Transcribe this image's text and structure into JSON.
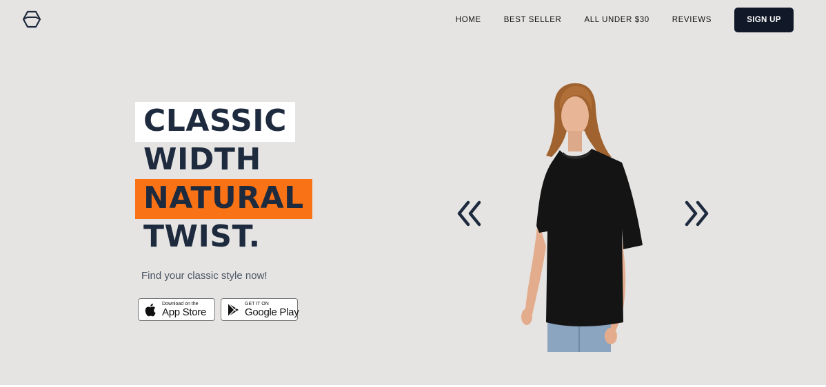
{
  "header": {
    "logo": "hexagon-logo-icon",
    "nav": [
      "HOME",
      "BEST SELLER",
      "ALL UNDER $30",
      "REVIEWS"
    ],
    "signup_label": "SIGN UP"
  },
  "hero": {
    "headline": [
      "CLASSIC",
      "WIDTH",
      "NATURAL",
      "TWIST."
    ],
    "subtitle": "Find your classic style now!",
    "app_store": {
      "small": "Download on the",
      "big": "App Store"
    },
    "google_play": {
      "small": "GET IT ON",
      "big": "Google Play"
    },
    "prev_icon": "double-chevron-left-icon",
    "next_icon": "double-chevron-right-icon"
  },
  "colors": {
    "background": "#e5e4e3",
    "accent": "#f97316",
    "dark": "#111827",
    "headline": "#1e2a3e"
  }
}
